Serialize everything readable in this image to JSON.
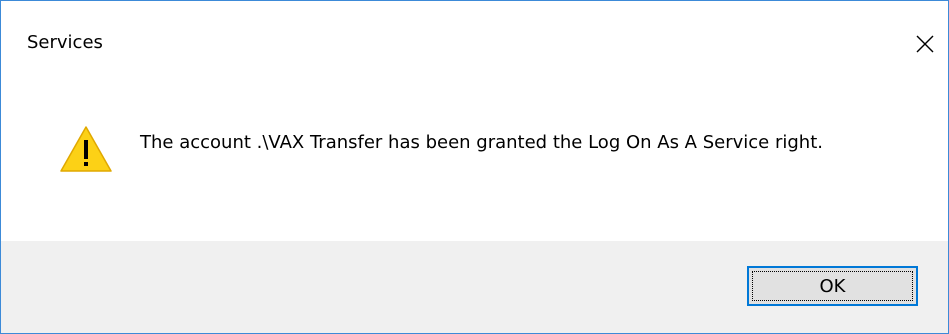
{
  "dialog": {
    "title": "Services",
    "message": "The account .\\VAX Transfer has been granted the Log On As A Service right.",
    "ok_label": "OK",
    "close_icon": "close-icon",
    "warning_icon": "warning-icon"
  },
  "colors": {
    "border": "#3c8ad8",
    "footer": "#f0f0f0",
    "button_face": "#e1e1e1",
    "button_focus": "#0078d7",
    "warning_fill": "#fcd116"
  }
}
